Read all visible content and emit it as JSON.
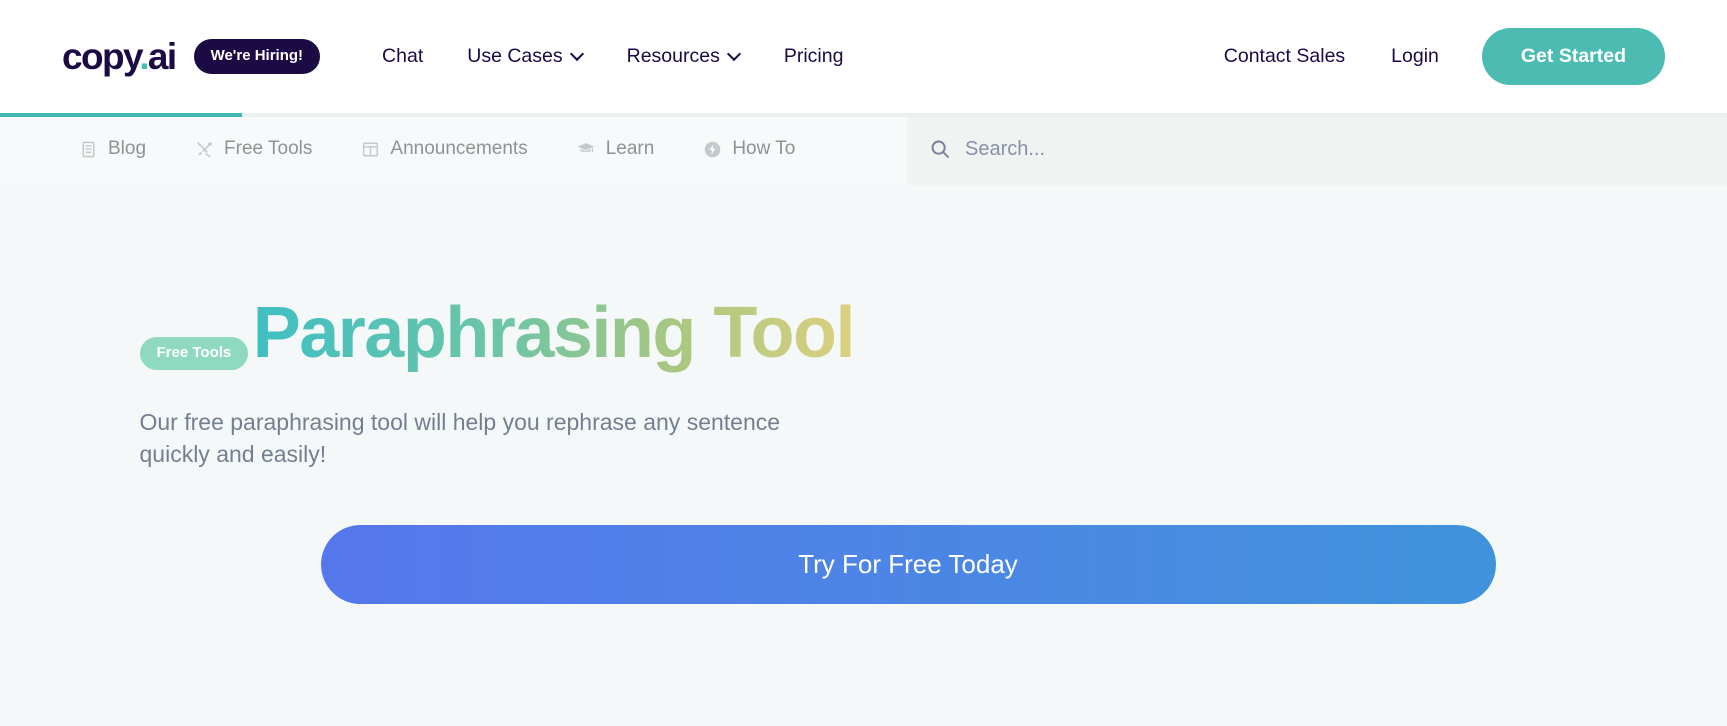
{
  "brand": {
    "name": "copy",
    "dot": ".",
    "suffix": "ai",
    "hiring_badge": "We're Hiring!"
  },
  "header": {
    "nav": [
      {
        "label": "Chat",
        "has_caret": false
      },
      {
        "label": "Use Cases",
        "has_caret": true
      },
      {
        "label": "Resources",
        "has_caret": true
      },
      {
        "label": "Pricing",
        "has_caret": false
      }
    ],
    "contact_sales": "Contact Sales",
    "login": "Login",
    "get_started": "Get Started",
    "accent_color": "#4cbcb3",
    "brand_dark": "#1b0a44"
  },
  "subnav": {
    "items": [
      {
        "label": "Blog",
        "icon": "book-icon"
      },
      {
        "label": "Free Tools",
        "icon": "tools-icon"
      },
      {
        "label": "Announcements",
        "icon": "layout-icon"
      },
      {
        "label": "Learn",
        "icon": "graduation-cap-icon"
      },
      {
        "label": "How To",
        "icon": "bolt-circle-icon"
      }
    ],
    "scroll_progress_color": "#41b8b3"
  },
  "search": {
    "placeholder": "Search...",
    "value": "",
    "icon": "search-icon"
  },
  "hero": {
    "tag": "Free Tools",
    "tag_color": "#8ed9c0",
    "title": "Paraphrasing Tool",
    "title_gradient_from": "#3fbfc4",
    "title_gradient_to": "#ddd080",
    "subtitle": "Our free paraphrasing tool will help you rephrase any sentence quickly and easily!",
    "cta_label": "Try For Free Today",
    "cta_gradient_from": "#5577ec",
    "cta_gradient_to": "#4093db"
  }
}
